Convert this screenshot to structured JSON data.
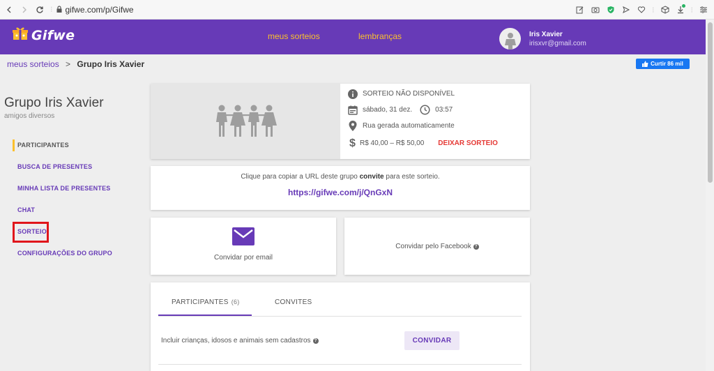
{
  "browser": {
    "url": "gifwe.com/p/Gifwe"
  },
  "header": {
    "logo_text": "Gifwe",
    "nav": [
      "meus sorteios",
      "lembranças"
    ],
    "user_name": "Iris Xavier",
    "user_email": "irisxvr@gmail.com"
  },
  "breadcrumb": {
    "link": "meus sorteios",
    "separator": ">",
    "current": "Grupo Iris Xavier"
  },
  "like_button": "Curtir 86 mil",
  "sidebar": {
    "title": "Grupo Iris Xavier",
    "subtitle": "amigos diversos",
    "items": [
      {
        "label": "PARTICIPANTES"
      },
      {
        "label": "BUSCA DE PRESENTES"
      },
      {
        "label": "MINHA LISTA DE PRESENTES"
      },
      {
        "label": "CHAT"
      },
      {
        "label": "SORTEIO"
      },
      {
        "label": "CONFIGURAÇÕES DO GRUPO"
      }
    ]
  },
  "event": {
    "status": "SORTEIO NÃO DISPONÍVEL",
    "date": "sábado, 31 dez.",
    "time": "03:57",
    "location": "Rua gerada automaticamente",
    "price_range": "R$ 40,00 – R$ 50,00",
    "leave_button": "DEIXAR SORTEIO"
  },
  "invite_url": {
    "text_before": "Clique para copiar a URL deste grupo",
    "text_bold": "convite",
    "text_after": "para este sorteio.",
    "url": "https://gifwe.com/j/QnGxN"
  },
  "invite_email_label": "Convidar por email",
  "invite_facebook_label": "Convidar pelo Facebook",
  "participants": {
    "tabs": [
      {
        "label": "PARTICIPANTES",
        "count": "(6)"
      },
      {
        "label": "CONVITES"
      }
    ],
    "include_text": "Incluir crianças, idosos e animais sem cadastros",
    "invite_button": "CONVIDAR"
  },
  "colors": {
    "primary": "#673ab7",
    "accent": "#fbc02d",
    "danger": "#e53935",
    "highlight": "#e0161b"
  }
}
